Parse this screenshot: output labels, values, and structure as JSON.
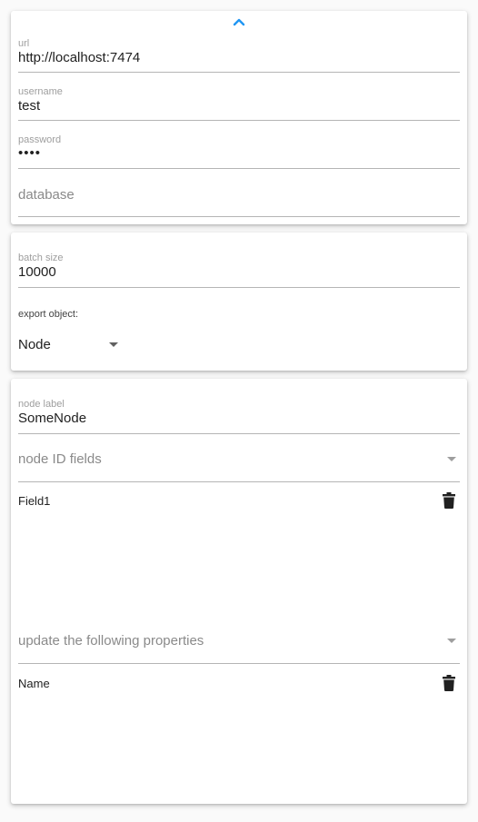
{
  "connection": {
    "url": {
      "label": "url",
      "value": "http://localhost:7474"
    },
    "username": {
      "label": "username",
      "value": "test"
    },
    "password": {
      "label": "password",
      "value": "••••"
    },
    "database": {
      "placeholder": "database",
      "value": ""
    }
  },
  "export": {
    "batch_size": {
      "label": "batch size",
      "value": "10000"
    },
    "export_object": {
      "label": "export object:",
      "value": "Node"
    }
  },
  "node": {
    "node_label": {
      "label": "node label",
      "value": "SomeNode"
    },
    "id_fields": {
      "placeholder": "node ID fields",
      "items": [
        "Field1"
      ]
    },
    "update_properties": {
      "placeholder": "update the following properties",
      "items": [
        "Name"
      ]
    }
  },
  "colors": {
    "accent": "#2196f3",
    "underline": "#b5b5b5",
    "label": "#9e9e9e",
    "text": "#212121"
  },
  "icons": {
    "collapse": "chevron-up-icon",
    "dropdown": "caret-down-icon",
    "delete": "trash-icon"
  }
}
